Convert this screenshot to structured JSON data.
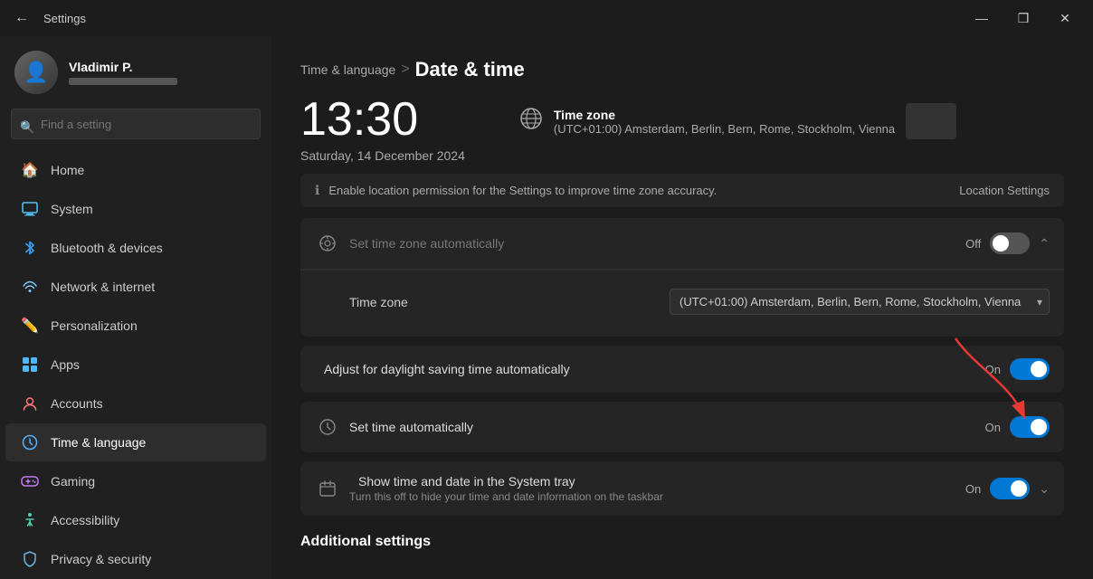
{
  "titlebar": {
    "title": "Settings",
    "btn_minimize": "—",
    "btn_maximize": "❐",
    "btn_close": "✕"
  },
  "sidebar": {
    "search_placeholder": "Find a setting",
    "user": {
      "name": "Vladimir P."
    },
    "items": [
      {
        "id": "home",
        "label": "Home",
        "icon": "🏠",
        "icon_class": "icon-home",
        "active": false
      },
      {
        "id": "system",
        "label": "System",
        "icon": "💻",
        "icon_class": "icon-system",
        "active": false
      },
      {
        "id": "bluetooth",
        "label": "Bluetooth & devices",
        "icon": "🔷",
        "icon_class": "icon-bluetooth",
        "active": false
      },
      {
        "id": "network",
        "label": "Network & internet",
        "icon": "🌐",
        "icon_class": "icon-network",
        "active": false
      },
      {
        "id": "personalization",
        "label": "Personalization",
        "icon": "🖊",
        "icon_class": "icon-personalization",
        "active": false
      },
      {
        "id": "apps",
        "label": "Apps",
        "icon": "📦",
        "icon_class": "icon-apps",
        "active": false
      },
      {
        "id": "accounts",
        "label": "Accounts",
        "icon": "👤",
        "icon_class": "icon-accounts",
        "active": false
      },
      {
        "id": "time",
        "label": "Time & language",
        "icon": "🕐",
        "icon_class": "icon-time",
        "active": true
      },
      {
        "id": "gaming",
        "label": "Gaming",
        "icon": "🎮",
        "icon_class": "icon-gaming",
        "active": false
      },
      {
        "id": "accessibility",
        "label": "Accessibility",
        "icon": "♿",
        "icon_class": "icon-accessibility",
        "active": false
      },
      {
        "id": "privacy",
        "label": "Privacy & security",
        "icon": "🛡",
        "icon_class": "icon-privacy",
        "active": false
      }
    ]
  },
  "main": {
    "breadcrumb_parent": "Time & language",
    "breadcrumb_sep": ">",
    "breadcrumb_current": "Date & time",
    "time_display": "13:30",
    "date_display": "Saturday, 14 December 2024",
    "timezone_label": "Time zone",
    "timezone_value": "(UTC+01:00) Amsterdam, Berlin, Bern, Rome, Stockholm, Vienna",
    "location_notice": "Enable location permission for the Settings to improve time zone accuracy.",
    "location_settings_link": "Location Settings",
    "set_timezone_auto_label": "Set time zone automatically",
    "set_timezone_auto_state": "Off",
    "timezone_dropdown_label": "Time zone",
    "timezone_dropdown_value": "(UTC+01:00) Amsterdam, Berlin, Bern, Rome, Stockholm, Vienna",
    "daylight_label": "Adjust for daylight saving time automatically",
    "daylight_state": "On",
    "set_time_auto_label": "Set time automatically",
    "set_time_auto_state": "On",
    "system_tray_label": "Show time and date in the System tray",
    "system_tray_desc": "Turn this off to hide your time and date information on the taskbar",
    "system_tray_state": "On",
    "additional_settings_label": "Additional settings"
  }
}
